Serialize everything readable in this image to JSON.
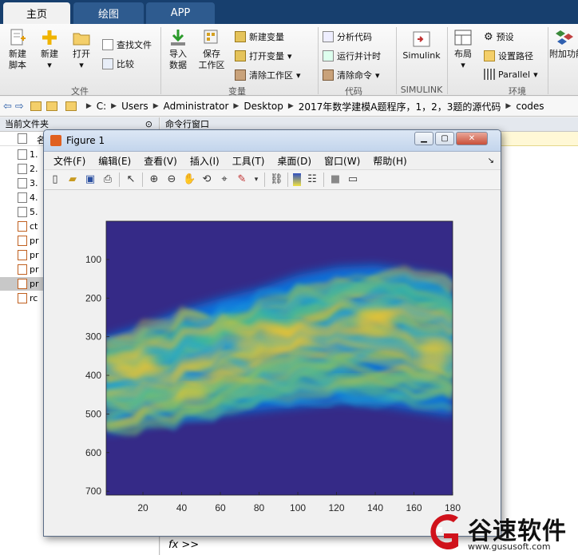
{
  "tabs": [
    {
      "label": "主页",
      "active": true
    },
    {
      "label": "绘图",
      "active": false
    },
    {
      "label": "APP",
      "active": false
    }
  ],
  "ribbon": {
    "new_script": "新建\n脚本",
    "new": "新建",
    "open": "打开",
    "find_files": "查找文件",
    "compare": "比较",
    "group_file": "文件",
    "import_data": "导入\n数据",
    "save_workspace": "保存\n工作区",
    "new_variable": "新建变量",
    "open_variable": "打开变量",
    "clear_workspace": "清除工作区",
    "group_variable": "变量",
    "analyze_code": "分析代码",
    "run_time": "运行并计时",
    "clear_commands": "清除命令",
    "group_code": "代码",
    "simulink": "Simulink",
    "group_simulink": "SIMULINK",
    "layout": "布局",
    "preferences": "预设",
    "set_path": "设置路径",
    "parallel": "Parallel",
    "group_env": "环境",
    "addons": "附加功能"
  },
  "address": {
    "parts": [
      "C:",
      "Users",
      "Administrator",
      "Desktop",
      "2017年数学建模A题程序，1，2，3题的源代码",
      "codes"
    ]
  },
  "left_panel": {
    "title": "当前文件夹",
    "column": "名",
    "files": [
      "1.",
      "2.",
      "3.",
      "4.",
      "5.",
      "ct",
      "pr",
      "pr",
      "pr",
      "pr",
      "rc"
    ]
  },
  "command_window": {
    "title": "命令行窗口",
    "prompt": "fx >>"
  },
  "figure": {
    "title": "Figure 1",
    "menus": [
      "文件(F)",
      "编辑(E)",
      "查看(V)",
      "插入(I)",
      "工具(T)",
      "桌面(D)",
      "窗口(W)",
      "帮助(H)"
    ]
  },
  "watermark": {
    "brand": "谷速软件",
    "url": "www.gususoft.com"
  },
  "chart_data": {
    "type": "heatmap",
    "colormap": "parula",
    "x_ticks": [
      20,
      40,
      60,
      80,
      100,
      120,
      140,
      160,
      180
    ],
    "y_ticks": [
      100,
      200,
      300,
      400,
      500,
      600,
      700
    ],
    "xlim": [
      1,
      180
    ],
    "ylim": [
      1,
      710
    ],
    "y_reversed": true,
    "bands": [
      {
        "name": "upper envelope",
        "values": [
          300,
          270,
          230,
          200,
          175,
          140,
          120,
          115,
          130,
          150
        ]
      },
      {
        "name": "lower envelope",
        "values": [
          550,
          530,
          510,
          500,
          490,
          480,
          470,
          475,
          490,
          505
        ]
      }
    ]
  }
}
